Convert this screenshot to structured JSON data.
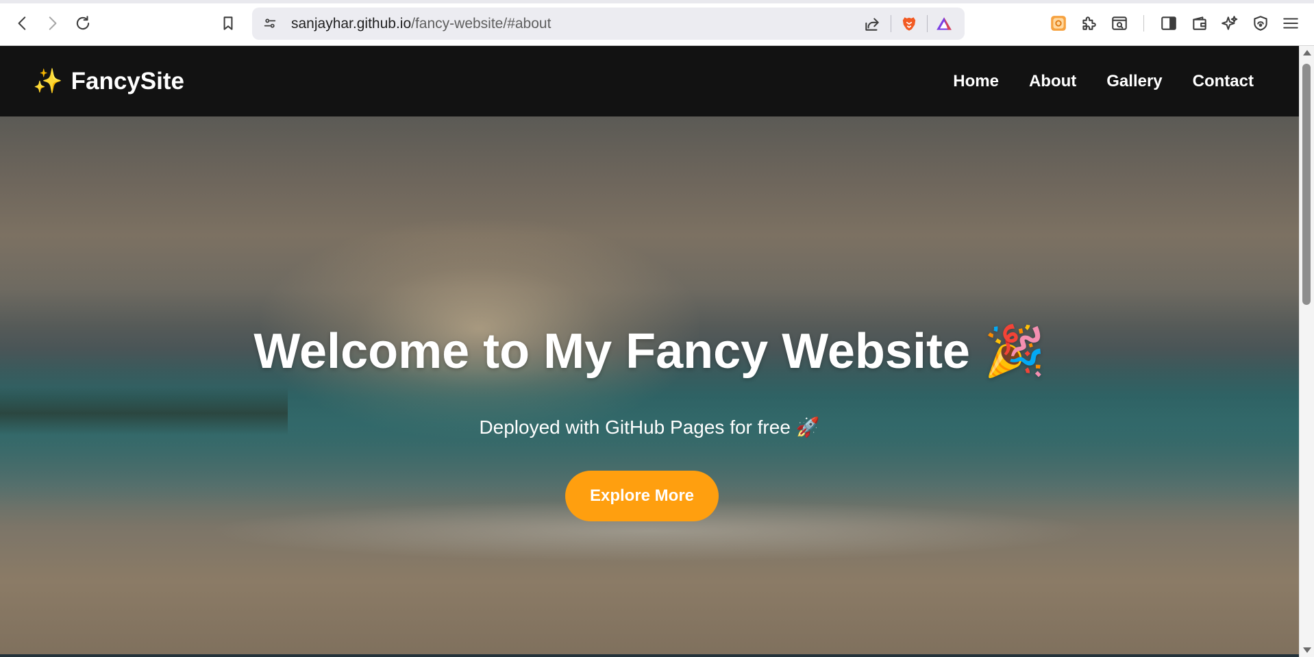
{
  "browser": {
    "url_host": "sanjayhar.github.io",
    "url_path": "/fancy-website/#about",
    "icons": {
      "back": "arrow-left-icon",
      "forward": "arrow-right-icon",
      "reload": "reload-icon",
      "bookmark": "bookmark-icon",
      "site_info": "site-settings-icon",
      "share": "share-icon",
      "brave_shields": "brave-lion-icon",
      "brave_rewards": "triangle-rewards-icon",
      "extension_1": "orange-extension-icon",
      "extensions": "puzzle-icon",
      "reader": "reader-search-icon",
      "sidebar": "sidebar-icon",
      "wallet": "wallet-icon",
      "leo": "sparkle-icon",
      "vpn": "shield-icon",
      "menu": "hamburger-menu-icon"
    }
  },
  "site": {
    "logo_emoji": "✨",
    "logo_text": "FancySite",
    "nav": [
      {
        "label": "Home"
      },
      {
        "label": "About"
      },
      {
        "label": "Gallery"
      },
      {
        "label": "Contact"
      }
    ]
  },
  "hero": {
    "title": "Welcome to My Fancy Website 🎉",
    "subtitle": "Deployed with GitHub Pages for free 🚀",
    "cta_label": "Explore More"
  },
  "colors": {
    "nav_background": "#121212",
    "cta_background": "#ff9f0f",
    "text_on_dark": "#ffffff"
  }
}
